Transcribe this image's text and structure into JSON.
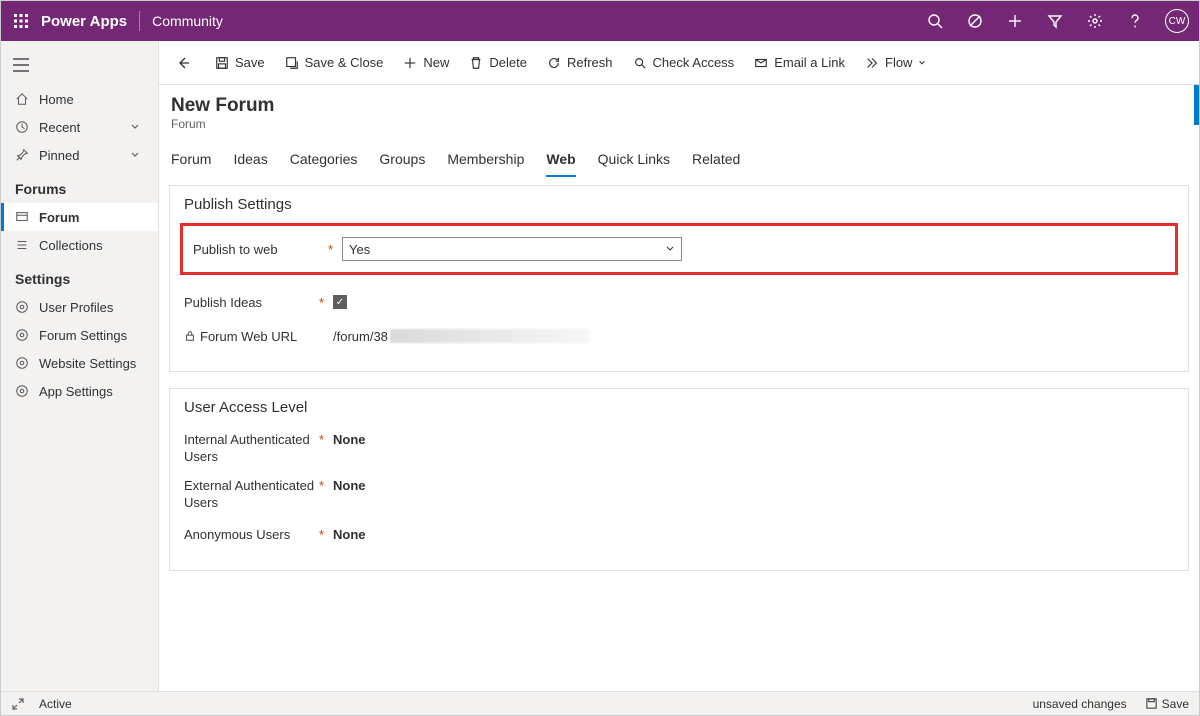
{
  "header": {
    "app_title": "Power Apps",
    "sub_label": "Community",
    "avatar_initials": "CW"
  },
  "sidebar": {
    "top": {
      "home": "Home",
      "recent": "Recent",
      "pinned": "Pinned"
    },
    "section1_title": "Forums",
    "section1_items": {
      "forum": "Forum",
      "collections": "Collections"
    },
    "section2_title": "Settings",
    "section2_items": {
      "user_profiles": "User Profiles",
      "forum_settings": "Forum Settings",
      "website_settings": "Website Settings",
      "app_settings": "App Settings"
    }
  },
  "commands": {
    "save": "Save",
    "save_close": "Save & Close",
    "new": "New",
    "delete": "Delete",
    "refresh": "Refresh",
    "check_access": "Check Access",
    "email_link": "Email a Link",
    "flow": "Flow"
  },
  "page": {
    "title": "New Forum",
    "entity": "Forum"
  },
  "tabs": {
    "forum": "Forum",
    "ideas": "Ideas",
    "categories": "Categories",
    "groups": "Groups",
    "membership": "Membership",
    "web": "Web",
    "quick_links": "Quick Links",
    "related": "Related"
  },
  "publish_settings": {
    "title": "Publish Settings",
    "publish_to_web_label": "Publish to web",
    "publish_to_web_value": "Yes",
    "publish_ideas_label": "Publish Ideas",
    "forum_web_url_label": "Forum Web URL",
    "forum_web_url_value": "/forum/38"
  },
  "user_access": {
    "title": "User Access Level",
    "internal_label": "Internal Authenticated Users",
    "internal_value": "None",
    "external_label": "External Authenticated Users",
    "external_value": "None",
    "anonymous_label": "Anonymous Users",
    "anonymous_value": "None"
  },
  "footer": {
    "status": "Active",
    "unsaved": "unsaved changes",
    "save": "Save"
  }
}
